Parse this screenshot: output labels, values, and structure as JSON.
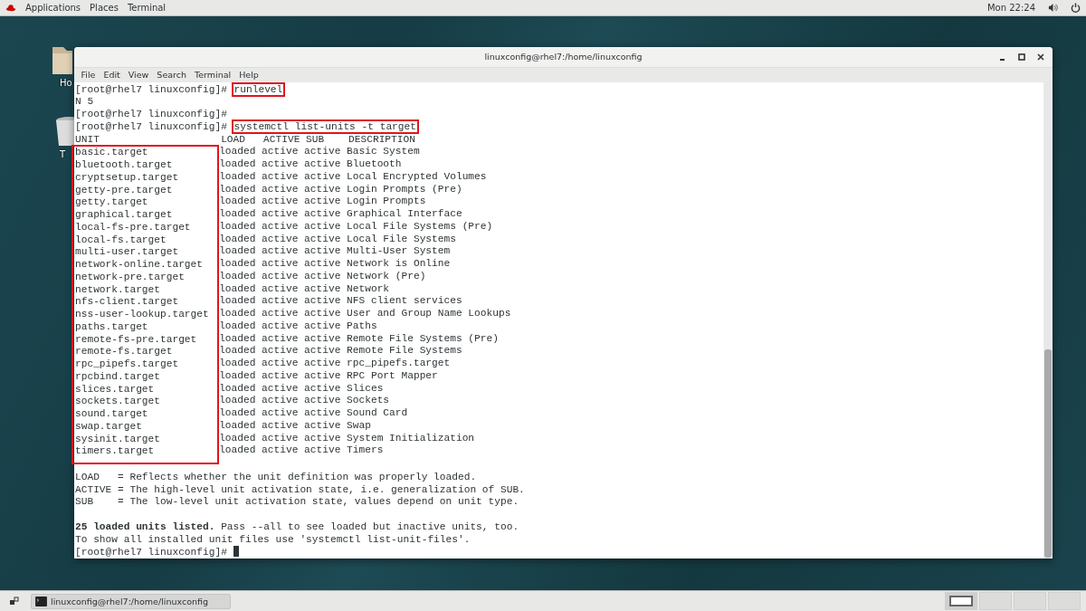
{
  "top_bar": {
    "menus": [
      "Applications",
      "Places",
      "Terminal"
    ],
    "clock": "Mon 22:24"
  },
  "desktop": {
    "icons": [
      {
        "kind": "folder",
        "label": "Ho"
      },
      {
        "kind": "trash",
        "label": "T"
      }
    ]
  },
  "window": {
    "title": "linuxconfig@rhel7:/home/linuxconfig",
    "menu": [
      "File",
      "Edit",
      "View",
      "Search",
      "Terminal",
      "Help"
    ]
  },
  "terminal": {
    "lines_before": [
      {
        "kind": "prompt",
        "prompt": "[root@rhel7 linuxconfig]# ",
        "command": "runlevel",
        "highlighted": true
      },
      {
        "kind": "output",
        "text": "N 5"
      },
      {
        "kind": "prompt",
        "prompt": "[root@rhel7 linuxconfig]# "
      },
      {
        "kind": "prompt",
        "prompt": "[root@rhel7 linuxconfig]# ",
        "command": "systemctl list-units -t target",
        "highlighted": true
      }
    ],
    "units_table": {
      "columns": [
        "UNIT",
        "LOAD",
        "ACTIVE",
        "SUB",
        "DESCRIPTION"
      ],
      "unit_column_highlighted": true,
      "rows": [
        {
          "unit": "basic.target",
          "load": "loaded",
          "active": "active",
          "sub": "active",
          "description": "Basic System"
        },
        {
          "unit": "bluetooth.target",
          "load": "loaded",
          "active": "active",
          "sub": "active",
          "description": "Bluetooth"
        },
        {
          "unit": "cryptsetup.target",
          "load": "loaded",
          "active": "active",
          "sub": "active",
          "description": "Local Encrypted Volumes"
        },
        {
          "unit": "getty-pre.target",
          "load": "loaded",
          "active": "active",
          "sub": "active",
          "description": "Login Prompts (Pre)"
        },
        {
          "unit": "getty.target",
          "load": "loaded",
          "active": "active",
          "sub": "active",
          "description": "Login Prompts"
        },
        {
          "unit": "graphical.target",
          "load": "loaded",
          "active": "active",
          "sub": "active",
          "description": "Graphical Interface"
        },
        {
          "unit": "local-fs-pre.target",
          "load": "loaded",
          "active": "active",
          "sub": "active",
          "description": "Local File Systems (Pre)"
        },
        {
          "unit": "local-fs.target",
          "load": "loaded",
          "active": "active",
          "sub": "active",
          "description": "Local File Systems"
        },
        {
          "unit": "multi-user.target",
          "load": "loaded",
          "active": "active",
          "sub": "active",
          "description": "Multi-User System"
        },
        {
          "unit": "network-online.target",
          "load": "loaded",
          "active": "active",
          "sub": "active",
          "description": "Network is Online"
        },
        {
          "unit": "network-pre.target",
          "load": "loaded",
          "active": "active",
          "sub": "active",
          "description": "Network (Pre)"
        },
        {
          "unit": "network.target",
          "load": "loaded",
          "active": "active",
          "sub": "active",
          "description": "Network"
        },
        {
          "unit": "nfs-client.target",
          "load": "loaded",
          "active": "active",
          "sub": "active",
          "description": "NFS client services"
        },
        {
          "unit": "nss-user-lookup.target",
          "load": "loaded",
          "active": "active",
          "sub": "active",
          "description": "User and Group Name Lookups"
        },
        {
          "unit": "paths.target",
          "load": "loaded",
          "active": "active",
          "sub": "active",
          "description": "Paths"
        },
        {
          "unit": "remote-fs-pre.target",
          "load": "loaded",
          "active": "active",
          "sub": "active",
          "description": "Remote File Systems (Pre)"
        },
        {
          "unit": "remote-fs.target",
          "load": "loaded",
          "active": "active",
          "sub": "active",
          "description": "Remote File Systems"
        },
        {
          "unit": "rpc_pipefs.target",
          "load": "loaded",
          "active": "active",
          "sub": "active",
          "description": "rpc_pipefs.target"
        },
        {
          "unit": "rpcbind.target",
          "load": "loaded",
          "active": "active",
          "sub": "active",
          "description": "RPC Port Mapper"
        },
        {
          "unit": "slices.target",
          "load": "loaded",
          "active": "active",
          "sub": "active",
          "description": "Slices"
        },
        {
          "unit": "sockets.target",
          "load": "loaded",
          "active": "active",
          "sub": "active",
          "description": "Sockets"
        },
        {
          "unit": "sound.target",
          "load": "loaded",
          "active": "active",
          "sub": "active",
          "description": "Sound Card"
        },
        {
          "unit": "swap.target",
          "load": "loaded",
          "active": "active",
          "sub": "active",
          "description": "Swap"
        },
        {
          "unit": "sysinit.target",
          "load": "loaded",
          "active": "active",
          "sub": "active",
          "description": "System Initialization"
        },
        {
          "unit": "timers.target",
          "load": "loaded",
          "active": "active",
          "sub": "active",
          "description": "Timers"
        }
      ]
    },
    "lines_after": [
      {
        "kind": "blank"
      },
      {
        "kind": "output",
        "text": "LOAD   = Reflects whether the unit definition was properly loaded."
      },
      {
        "kind": "output",
        "text": "ACTIVE = The high-level unit activation state, i.e. generalization of SUB."
      },
      {
        "kind": "output",
        "text": "SUB    = The low-level unit activation state, values depend on unit type."
      },
      {
        "kind": "blank"
      },
      {
        "kind": "output",
        "text": "**25 loaded units listed.** Pass --all to see loaded but inactive units, too."
      },
      {
        "kind": "output",
        "text": "To show all installed unit files use 'systemctl list-unit-files'."
      },
      {
        "kind": "prompt",
        "prompt": "[root@rhel7 linuxconfig]# ",
        "cursor": true
      }
    ]
  },
  "taskbar": {
    "task": "linuxconfig@rhel7:/home/linuxconfig",
    "workspaces": [
      {
        "selected": true
      },
      {
        "selected": false
      },
      {
        "selected": false
      },
      {
        "selected": false
      }
    ]
  }
}
